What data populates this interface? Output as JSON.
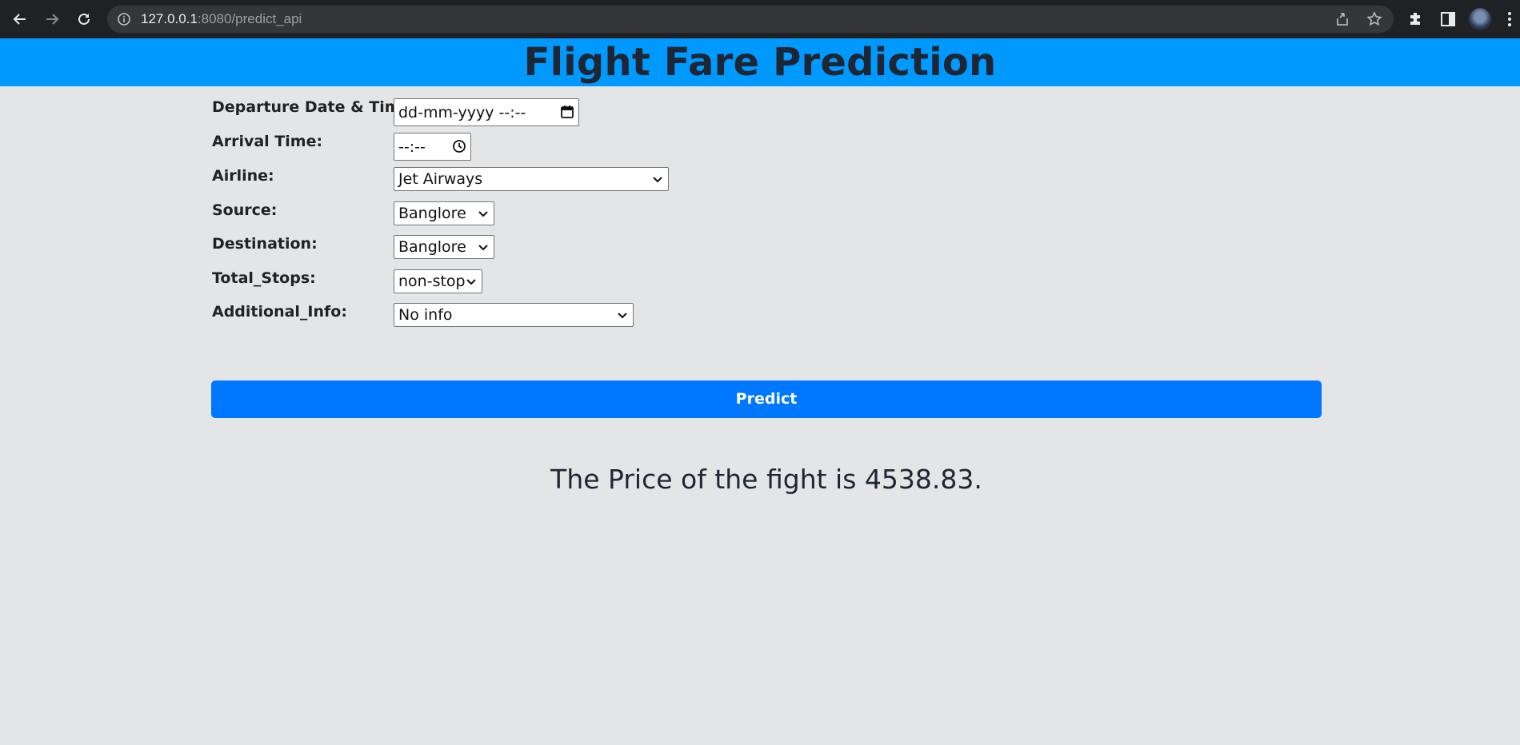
{
  "browser": {
    "url_host": "127.0.0.1",
    "url_rest": ":8080/predict_api",
    "icons": [
      "back-arrow-icon",
      "forward-arrow-icon",
      "reload-icon",
      "info-icon",
      "share-icon",
      "star-icon",
      "extensions-icon",
      "side-panel-icon",
      "profile-avatar",
      "menu-dots-icon"
    ]
  },
  "header": {
    "title": "Flight Fare Prediction",
    "background": "#0099ff"
  },
  "form": {
    "departure": {
      "label": "Departure Date & Time:",
      "placeholder": "dd-mm-yyyy --:--"
    },
    "arrival": {
      "label": "Arrival Time:",
      "placeholder": "--:--"
    },
    "airline": {
      "label": "Airline:",
      "value": "Jet Airways"
    },
    "source": {
      "label": "Source:",
      "value": "Banglore"
    },
    "destination": {
      "label": "Destination:",
      "value": "Banglore"
    },
    "total_stops": {
      "label": "Total_Stops:",
      "value": "non-stop"
    },
    "additional_info": {
      "label": "Additional_Info:",
      "value": "No info"
    }
  },
  "predict_button": {
    "label": "Predict",
    "color": "#0077ff"
  },
  "result": {
    "text": "The Price of the fight is 4538.83."
  }
}
